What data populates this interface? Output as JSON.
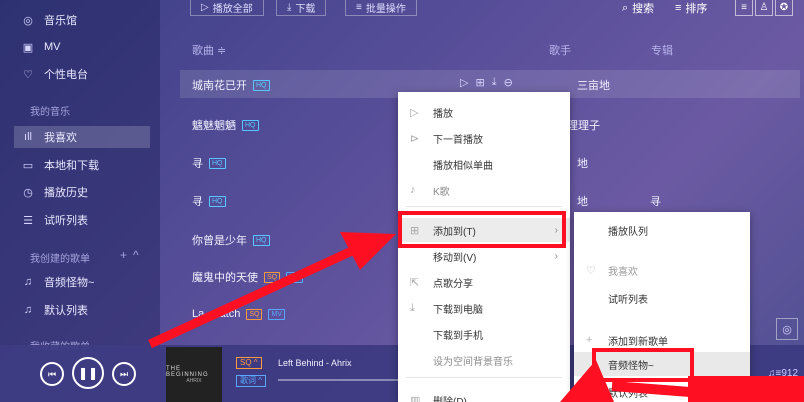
{
  "toolbar": {
    "play_all": "播放全部",
    "download": "下载",
    "batch": "批量操作",
    "search": "搜索",
    "sort": "排序"
  },
  "sidebar": {
    "top_items": [
      {
        "label": "音乐馆",
        "icon": "music-hall-icon"
      },
      {
        "label": "MV",
        "icon": "mv-icon"
      },
      {
        "label": "个性电台",
        "icon": "radio-icon"
      }
    ],
    "my_music_title": "我的音乐",
    "my_music_items": [
      {
        "label": "我喜欢",
        "icon": "bars-icon"
      },
      {
        "label": "本地和下载",
        "icon": "monitor-icon"
      },
      {
        "label": "播放历史",
        "icon": "clock-icon"
      },
      {
        "label": "试听列表",
        "icon": "list-icon"
      }
    ],
    "created_title": "我创建的歌单",
    "created_items": [
      {
        "label": "音频怪物~",
        "icon": "note-icon"
      },
      {
        "label": "默认列表",
        "icon": "note-icon"
      }
    ],
    "collected_title": "我收藏的歌单"
  },
  "table": {
    "col_song": "歌曲 ≑",
    "col_singer": "歌手",
    "col_album": "专辑",
    "rows": [
      {
        "title": "城南花已开",
        "badges": [
          "HQ"
        ],
        "singer": "三亩地",
        "album": ""
      },
      {
        "title": "魑魅魍魉",
        "badges": [
          "HQ"
        ],
        "singer": "理理子",
        "album": ""
      },
      {
        "title": "寻",
        "badges": [
          "HQ"
        ],
        "singer": "地",
        "album": ""
      },
      {
        "title": "寻",
        "badges": [
          "HQ"
        ],
        "singer": "地",
        "album": "寻"
      },
      {
        "title": "你曾是少年",
        "badges": [
          "HQ"
        ],
        "singer": "",
        "album": ""
      },
      {
        "title": "魔鬼中的天使",
        "badges": [
          "SQ",
          "MV"
        ],
        "singer": "",
        "album": ""
      },
      {
        "title": "La     atch",
        "badges": [
          "SQ",
          "MV"
        ],
        "singer": "",
        "album": ""
      }
    ]
  },
  "context_menu": {
    "items": [
      {
        "label": "播放",
        "icon": "play-icon"
      },
      {
        "label": "下一首播放",
        "icon": "play-next-icon"
      },
      {
        "label": "播放相似单曲",
        "icon": ""
      },
      {
        "label": "K歌",
        "icon": "mic-icon"
      },
      {
        "label": "添加到(T)",
        "icon": "add-icon"
      },
      {
        "label": "移动到(V)",
        "icon": ""
      },
      {
        "label": "点歌分享",
        "icon": "share-icon"
      },
      {
        "label": "下载到电脑",
        "icon": "download-icon"
      },
      {
        "label": "下载到手机",
        "icon": ""
      },
      {
        "label": "设为空间背景音乐",
        "icon": ""
      },
      {
        "label": "删除(D)",
        "icon": "trash-icon"
      }
    ]
  },
  "submenu": {
    "items": [
      {
        "label": "播放队列"
      },
      {
        "label": "我喜欢"
      },
      {
        "label": "试听列表"
      },
      {
        "label": "添加到新歌单"
      },
      {
        "label": "音频怪物~"
      },
      {
        "label": "默认列表"
      }
    ]
  },
  "player": {
    "cover_title": "THE BEGINNING",
    "cover_sub": "AHRIX",
    "quality": "SQ",
    "mode": "歌词",
    "now_playing": "Left Behind - Ahrix",
    "playlist_count": "912"
  }
}
